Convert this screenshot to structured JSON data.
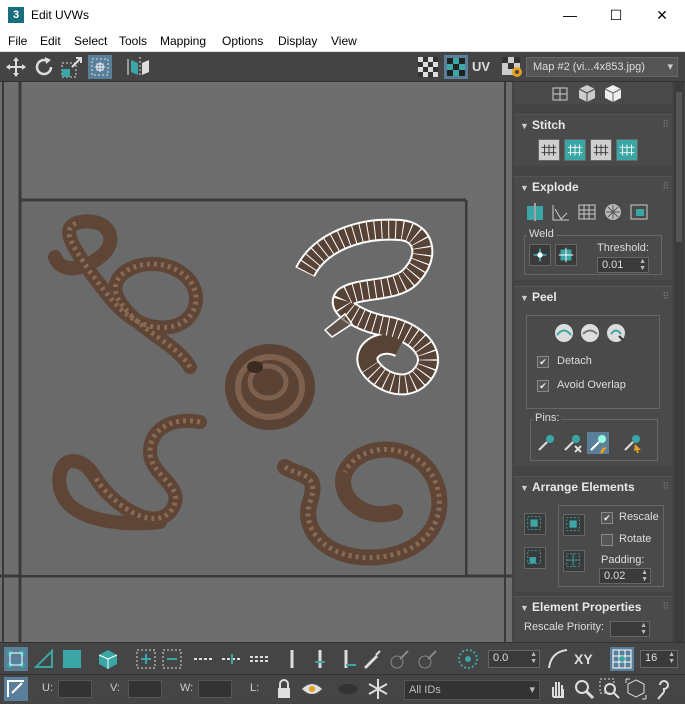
{
  "window": {
    "app_icon": "3",
    "title": "Edit UVWs",
    "controls": {
      "minimize": "—",
      "maximize": "☐",
      "close": "✕"
    }
  },
  "menu": [
    "File",
    "Edit",
    "Select",
    "Tools",
    "Mapping",
    "Options",
    "Display",
    "View"
  ],
  "toolbar": {
    "uv_label": "UV",
    "map_selector": "Map #2 (vi...4x853.jpg)"
  },
  "panel": {
    "stitch": {
      "title": "Stitch"
    },
    "explode": {
      "title": "Explode",
      "weld_label": "Weld",
      "threshold_label": "Threshold:",
      "threshold_value": "0.01"
    },
    "peel": {
      "title": "Peel",
      "detach_label": "Detach",
      "detach_checked": true,
      "avoid_overlap_label": "Avoid Overlap",
      "avoid_overlap_checked": true,
      "pins_label": "Pins:"
    },
    "arrange": {
      "title": "Arrange Elements",
      "rescale_label": "Rescale",
      "rescale_checked": true,
      "rotate_label": "Rotate",
      "rotate_checked": false,
      "padding_label": "Padding:",
      "padding_value": "0.02"
    },
    "element_props": {
      "title": "Element Properties",
      "rescale_priority_label": "Rescale Priority:"
    }
  },
  "bottom": {
    "angle_value": "0.0",
    "xy_label": "XY",
    "grid_value": "16",
    "u_label": "U:",
    "v_label": "V:",
    "w_label": "W:",
    "l_label": "L:",
    "ids_value": "All IDs"
  },
  "colors": {
    "teal": "#3aa6a6",
    "viewport_bg": "#6b6b6b",
    "panel_bg": "#444444"
  }
}
